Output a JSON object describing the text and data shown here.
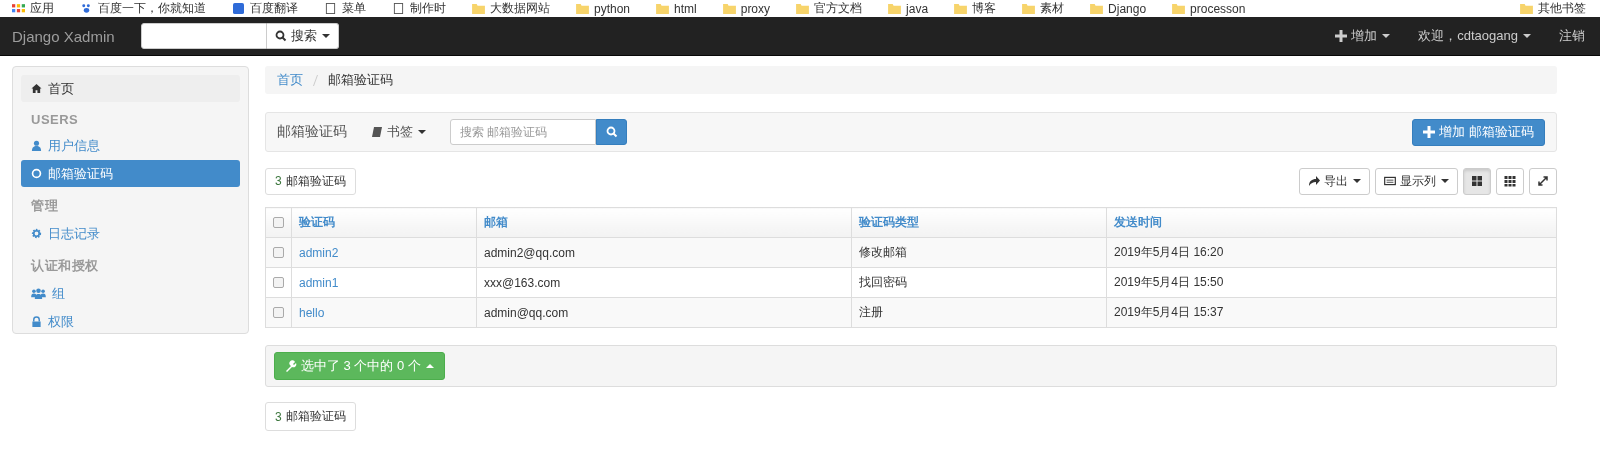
{
  "bookmarks": [
    {
      "label": "应用"
    },
    {
      "label": "百度一下，你就知道"
    },
    {
      "label": "百度翻译"
    },
    {
      "label": "菜单"
    },
    {
      "label": "制作时"
    },
    {
      "label": "大数据网站"
    },
    {
      "label": "python"
    },
    {
      "label": "html"
    },
    {
      "label": "proxy"
    },
    {
      "label": "官方文档"
    },
    {
      "label": "java"
    },
    {
      "label": "博客"
    },
    {
      "label": "素材"
    },
    {
      "label": "Django"
    },
    {
      "label": "processon"
    }
  ],
  "other_bookmarks": "其他书签",
  "navbar": {
    "brand": "Django Xadmin",
    "search_button": "搜索",
    "add": "增加",
    "welcome": "欢迎，cdtaogang",
    "logout": "注销"
  },
  "sidebar": [
    {
      "kind": "item",
      "label": "首页",
      "selected": false,
      "highlight": true
    },
    {
      "kind": "header",
      "label": "USERS"
    },
    {
      "kind": "item",
      "label": "用户信息",
      "selected": false,
      "highlight": false
    },
    {
      "kind": "item",
      "label": "邮箱验证码",
      "selected": true,
      "highlight": false
    },
    {
      "kind": "header",
      "label": "管理"
    },
    {
      "kind": "item",
      "label": "日志记录",
      "selected": false,
      "highlight": false
    },
    {
      "kind": "header",
      "label": "认证和授权"
    },
    {
      "kind": "item",
      "label": "组",
      "selected": false,
      "highlight": false
    },
    {
      "kind": "item",
      "label": "权限",
      "selected": false,
      "highlight": false
    }
  ],
  "breadcrumb": [
    "首页",
    "邮箱验证码"
  ],
  "toolbar": {
    "title": "邮箱验证码",
    "bookmarks": "书签",
    "search_placeholder": "搜索 邮箱验证码",
    "add_button": "增加 邮箱验证码"
  },
  "count": {
    "number": "3",
    "label": "邮箱验证码"
  },
  "actions": {
    "export": "导出",
    "columns": "显示列"
  },
  "table": {
    "all_checked": false,
    "columns": [
      "验证码",
      "邮箱",
      "验证码类型",
      "发送时间"
    ],
    "rows": [
      {
        "checked": false,
        "cells": [
          "admin2",
          "admin2@qq.com",
          "修改邮箱",
          "2019年5月4日 16:20"
        ]
      },
      {
        "checked": false,
        "cells": [
          "admin1",
          "xxx@163.com",
          "找回密码",
          "2019年5月4日 15:50"
        ]
      },
      {
        "checked": false,
        "cells": [
          "hello",
          "admin@qq.com",
          "注册",
          "2019年5月4日 15:37"
        ]
      }
    ]
  },
  "selection_button": "选中了 3 个中的 0 个",
  "bottom_count": {
    "number": "3",
    "label": "邮箱验证码"
  }
}
